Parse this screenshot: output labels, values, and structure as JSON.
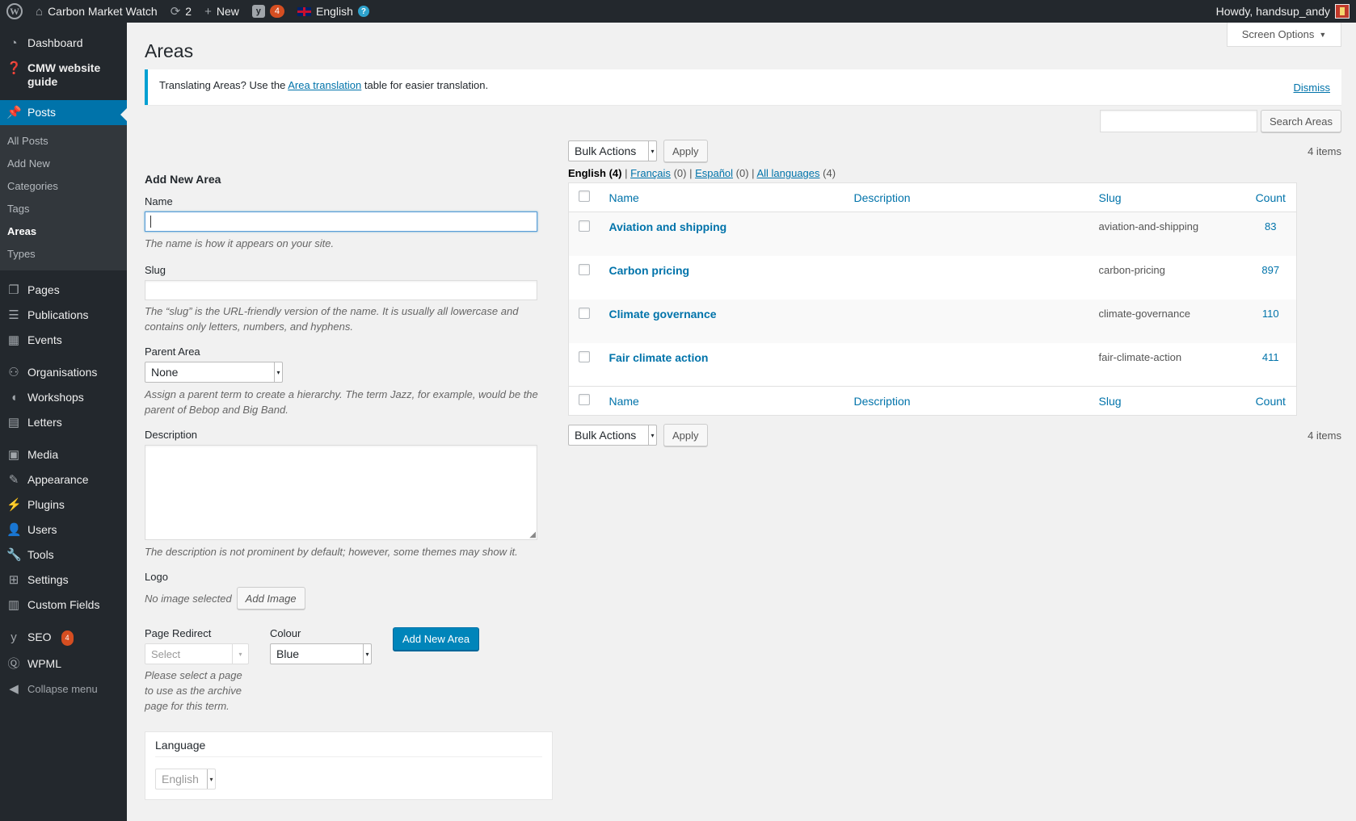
{
  "adminbar": {
    "site_name": "Carbon Market Watch",
    "updates_count": "2",
    "new_label": "New",
    "seo_count": "4",
    "language": "English",
    "howdy": "Howdy, handsup_andy"
  },
  "sidebar": {
    "items_top": [
      {
        "label": "Dashboard",
        "icon": "dashboard-icon"
      },
      {
        "label": "CMW website guide",
        "icon": "help-icon"
      }
    ],
    "current": {
      "label": "Posts",
      "icon": "pin-icon"
    },
    "submenu": [
      "All Posts",
      "Add New",
      "Categories",
      "Tags",
      "Areas",
      "Types"
    ],
    "submenu_current": "Areas",
    "group1": [
      {
        "label": "Pages",
        "icon": "pages-icon"
      },
      {
        "label": "Publications",
        "icon": "list-icon"
      },
      {
        "label": "Events",
        "icon": "calendar-icon"
      }
    ],
    "group2": [
      {
        "label": "Organisations",
        "icon": "groups-icon"
      },
      {
        "label": "Workshops",
        "icon": "megaphone-icon"
      },
      {
        "label": "Letters",
        "icon": "document-icon"
      }
    ],
    "group3": [
      {
        "label": "Media",
        "icon": "media-icon"
      },
      {
        "label": "Appearance",
        "icon": "brush-icon"
      },
      {
        "label": "Plugins",
        "icon": "plug-icon"
      },
      {
        "label": "Users",
        "icon": "user-icon"
      },
      {
        "label": "Tools",
        "icon": "wrench-icon"
      },
      {
        "label": "Settings",
        "icon": "settings-icon"
      },
      {
        "label": "Custom Fields",
        "icon": "fields-icon"
      }
    ],
    "seo": {
      "label": "SEO",
      "badge": "4"
    },
    "wpml": "WPML",
    "collapse": "Collapse menu"
  },
  "screen_options": "Screen Options",
  "page_title": "Areas",
  "notice": {
    "before": "Translating Areas? Use the ",
    "link": "Area translation",
    "after": " table for easier translation.",
    "dismiss": "Dismiss"
  },
  "form": {
    "heading": "Add New Area",
    "name_label": "Name",
    "name_desc": "The name is how it appears on your site.",
    "slug_label": "Slug",
    "slug_desc": "The “slug” is the URL-friendly version of the name. It is usually all lowercase and contains only letters, numbers, and hyphens.",
    "parent_label": "Parent Area",
    "parent_value": "None",
    "parent_desc": "Assign a parent term to create a hierarchy. The term Jazz, for example, would be the parent of Bebop and Big Band.",
    "desc_label": "Description",
    "desc_desc": "The description is not prominent by default; however, some themes may show it.",
    "logo_label": "Logo",
    "logo_status": "No image selected",
    "add_image": "Add Image",
    "redirect_label": "Page Redirect",
    "redirect_value": "Select",
    "redirect_desc": "Please select a page to use as the archive page for this term.",
    "colour_label": "Colour",
    "colour_value": "Blue",
    "submit": "Add New Area",
    "language_label": "Language",
    "language_value": "English"
  },
  "search": {
    "button": "Search Areas"
  },
  "bulk": {
    "label": "Bulk Actions",
    "apply": "Apply",
    "items": "4 items"
  },
  "langfilter": {
    "current": "English",
    "current_count": "(4)",
    "fr": "Français",
    "fr_count": "(0)",
    "es": "Español",
    "es_count": "(0)",
    "all": "All languages",
    "all_count": "(4)"
  },
  "table": {
    "columns": [
      "Name",
      "Description",
      "Slug",
      "Count"
    ],
    "rows": [
      {
        "name": "Aviation and shipping",
        "description": "",
        "slug": "aviation-and-shipping",
        "count": "83"
      },
      {
        "name": "Carbon pricing",
        "description": "",
        "slug": "carbon-pricing",
        "count": "897"
      },
      {
        "name": "Climate governance",
        "description": "",
        "slug": "climate-governance",
        "count": "110"
      },
      {
        "name": "Fair climate action",
        "description": "",
        "slug": "fair-climate-action",
        "count": "411"
      }
    ]
  },
  "colors": {
    "accent": "#0073aa",
    "sidebar": "#23282d",
    "badge": "#d54e21",
    "primary_button": "#0085ba"
  }
}
